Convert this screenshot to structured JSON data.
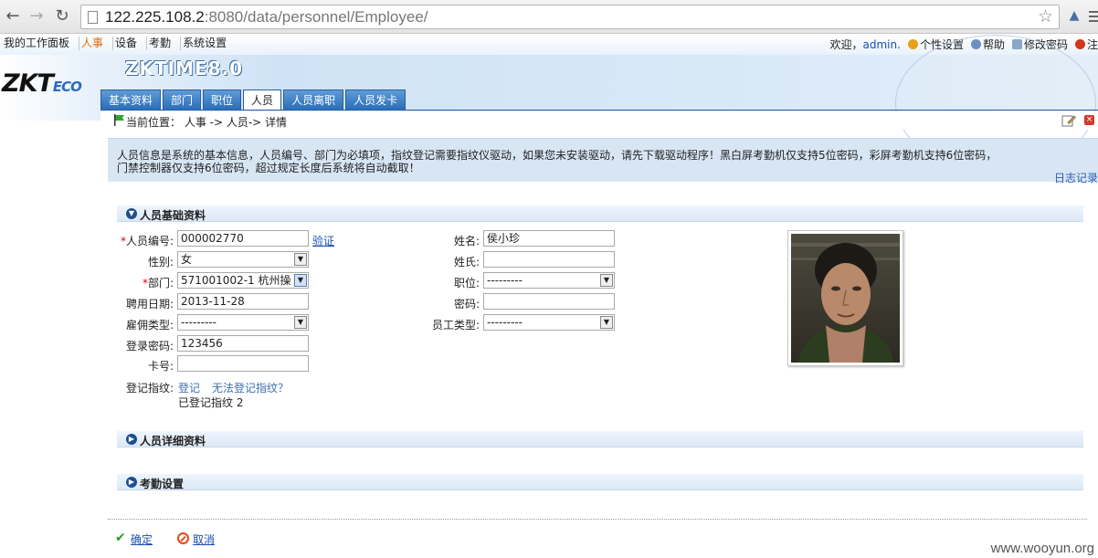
{
  "browser": {
    "url_host": "122.225.108.2",
    "url_rest": ":8080/data/personnel/Employee/"
  },
  "topmenu": [
    "我的工作面板",
    "人事",
    "设备",
    "考勤",
    "系统设置"
  ],
  "usernav": {
    "welcome": "欢迎，",
    "user": "admin.",
    "personal": "个性设置",
    "help": "帮助",
    "change_pw": "修改密码",
    "logout": "注"
  },
  "brand": {
    "logo": "ZKT",
    "logo_eco": "ECO",
    "product": "ZKTIME8.0"
  },
  "tabs": [
    "基本资料",
    "部门",
    "职位",
    "人员",
    "人员离职",
    "人员发卡"
  ],
  "breadcrumb": "当前位置： 人事 -> 人员-> 详情",
  "notice": {
    "line1": "人员信息是系统的基本信息，人员编号、部门为必填项，指纹登记需要指纹仪驱动，如果您未安装驱动，请先下载驱动程序！黑白屏考勤机仅支持5位密码，彩屏考勤机支持6位密码，",
    "line2": "门禁控制器仅支持6位密码，超过规定长度后系统将自动截取！",
    "log_link": "日志记录"
  },
  "sections": {
    "basic": "人员基础资料",
    "detail": "人员详细资料",
    "attendance": "考勤设置"
  },
  "form": {
    "emp_no": {
      "label": "人员编号:",
      "value": "000002770",
      "verify": "验证"
    },
    "gender": {
      "label": "性别:",
      "value": "女"
    },
    "dept": {
      "label": "部门:",
      "value": "571001002-1 杭州操"
    },
    "hire_date": {
      "label": "聘用日期:",
      "value": "2013-11-28"
    },
    "emp_kind": {
      "label": "雇佣类型:",
      "value": "---------"
    },
    "login_pw": {
      "label": "登录密码:",
      "value": "123456"
    },
    "card_no": {
      "label": "卡号:",
      "value": ""
    },
    "fingerprint": {
      "label": "登记指纹:",
      "register": "登记",
      "cannot": "无法登记指纹？",
      "status": "已登记指纹 2"
    },
    "name": {
      "label": "姓名:",
      "value": "侯小珍"
    },
    "surname": {
      "label": "姓氏:",
      "value": ""
    },
    "position": {
      "label": "职位:",
      "value": "---------"
    },
    "password": {
      "label": "密码:",
      "value": ""
    },
    "staff_type": {
      "label": "员工类型:",
      "value": "---------"
    }
  },
  "actions": {
    "ok": "确定",
    "cancel": "取消"
  },
  "watermark": "www.wooyun.org"
}
